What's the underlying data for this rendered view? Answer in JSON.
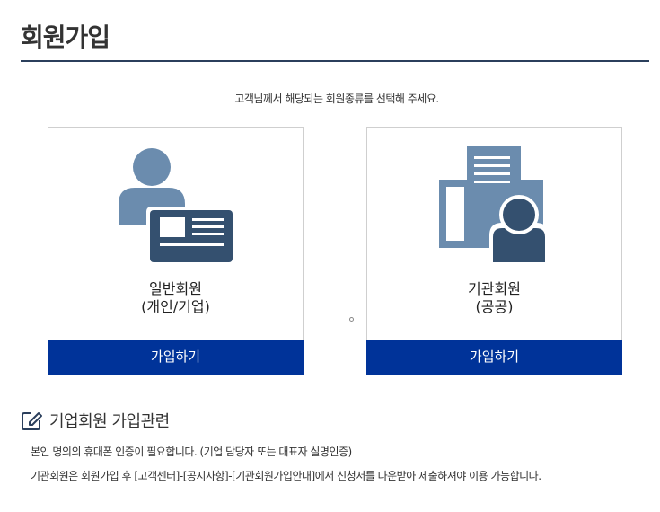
{
  "page": {
    "title": "회원가입",
    "intro": "고객님께서 해당되는 회원종류를 선택해 주세요."
  },
  "cards": [
    {
      "name_line1": "일반회원",
      "name_line2": "(개인/기업)",
      "button": "가입하기",
      "icon": "person-id-card-icon"
    },
    {
      "name_line1": "기관회원",
      "name_line2": "(공공)",
      "button": "가입하기",
      "icon": "building-person-icon"
    }
  ],
  "section": {
    "heading": "기업회원 가입관련",
    "icon": "edit-icon",
    "notes": [
      "본인 명의의 휴대폰 인증이 필요합니다. (기업 담당자 또는 대표자 실명인증)",
      "기관회원은 회원가입 후 [고객센터]-[공지사항]-[기관회원가입안내]에서 신청서를 다운받아 제출하셔야 이용 가능합니다."
    ]
  },
  "colors": {
    "primary": "#003399",
    "icon_light": "#6b8cae",
    "icon_dark": "#34506f",
    "rule": "#2b3f5c"
  }
}
